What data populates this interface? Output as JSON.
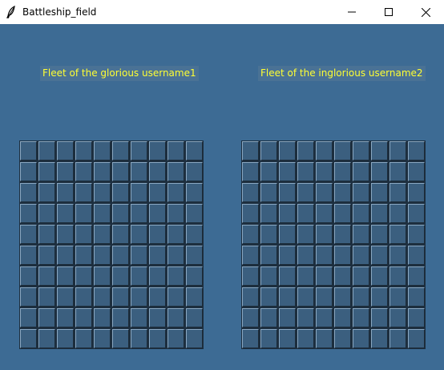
{
  "window": {
    "title": "Battleship_field"
  },
  "icons": {
    "app": "feather-icon",
    "minimize": "minimize-icon",
    "maximize": "maximize-icon",
    "close": "close-icon"
  },
  "player1": {
    "label": "Fleet of the glorious username1",
    "grid": {
      "rows": 10,
      "cols": 10
    }
  },
  "player2": {
    "label": "Fleet of the inglorious username2",
    "grid": {
      "rows": 10,
      "cols": 10
    }
  },
  "colors": {
    "background": "#3d6b94",
    "label_text": "#ffff33",
    "cell_fill": "#3b5f7f"
  }
}
